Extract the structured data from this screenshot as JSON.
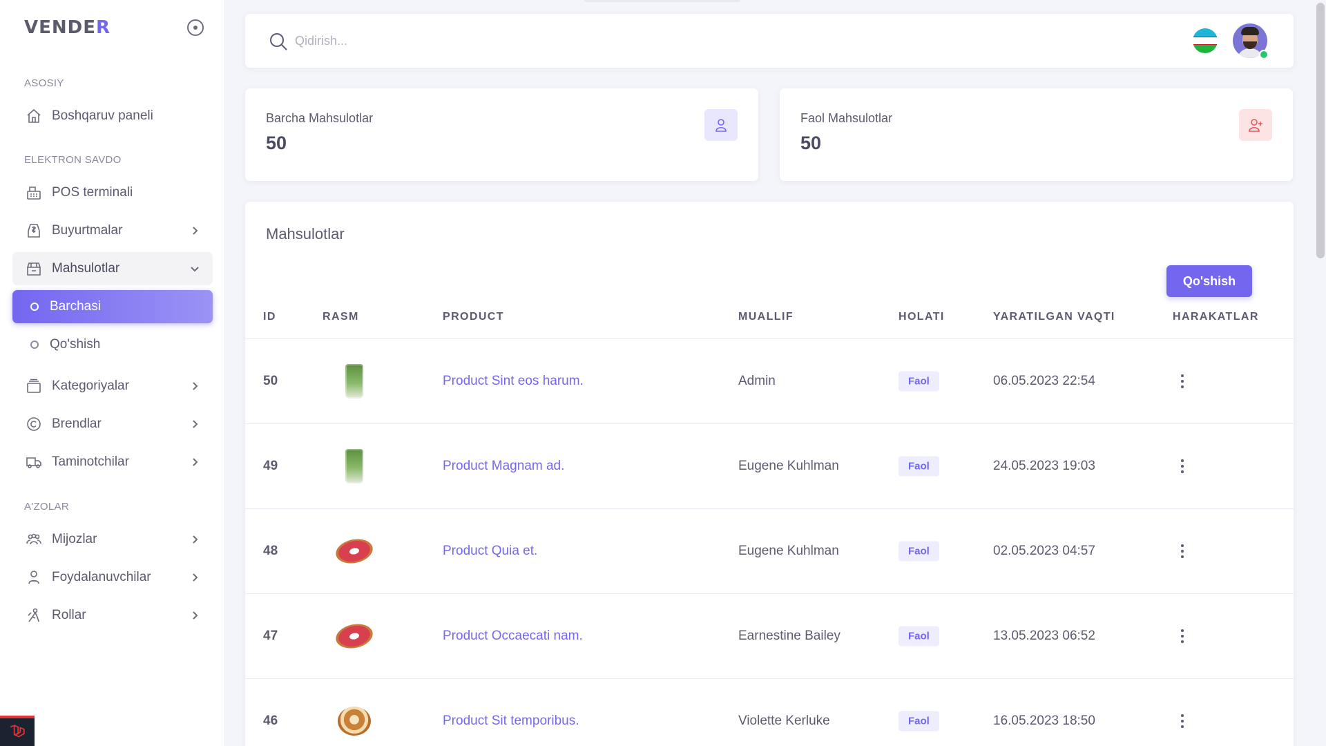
{
  "brand": {
    "text_main": "VENDE",
    "text_accent": "R"
  },
  "search": {
    "placeholder": "Qidirish..."
  },
  "colors": {
    "accent": "#7367f0",
    "danger": "#ea5455",
    "success": "#28c76f"
  },
  "sidebar": {
    "sections": [
      "ASOSIY",
      "ELEKTRON SAVDO",
      "A'ZOLAR"
    ],
    "items": [
      {
        "label": "Boshqaruv paneli",
        "icon": "home-icon"
      },
      {
        "label": "POS terminali",
        "icon": "cash-register-icon"
      },
      {
        "label": "Buyurtmalar",
        "icon": "order-icon"
      },
      {
        "label": "Mahsulotlar",
        "icon": "products-icon"
      },
      {
        "label": "Barchasi",
        "icon": "circle-icon"
      },
      {
        "label": "Qo'shish",
        "icon": "circle-icon"
      },
      {
        "label": "Kategoriyalar",
        "icon": "category-icon"
      },
      {
        "label": "Brendlar",
        "icon": "copyright-icon"
      },
      {
        "label": "Taminotchilar",
        "icon": "truck-icon"
      },
      {
        "label": "Mijozlar",
        "icon": "users-icon"
      },
      {
        "label": "Foydalanuvchilar",
        "icon": "user-icon"
      },
      {
        "label": "Rollar",
        "icon": "roles-icon"
      }
    ]
  },
  "stats": [
    {
      "label": "Barcha Mahsulotlar",
      "value": "50",
      "icon": "user-icon",
      "color": "#7367f0"
    },
    {
      "label": "Faol Mahsulotlar",
      "value": "50",
      "icon": "user-plus-icon",
      "color": "#ea5455"
    }
  ],
  "products": {
    "title": "Mahsulotlar",
    "add_label": "Qo'shish",
    "columns": [
      "ID",
      "RASM",
      "PRODUCT",
      "MUALLIF",
      "HOLATI",
      "YARATILGAN VAQTI",
      "HARAKATLAR"
    ],
    "rows": [
      {
        "id": "50",
        "image": "green-drink",
        "name": "Product Sint eos harum.",
        "author": "Admin",
        "status": "Faol",
        "created": "06.05.2023 22:54"
      },
      {
        "id": "49",
        "image": "green-drink",
        "name": "Product Magnam ad.",
        "author": "Eugene Kuhlman",
        "status": "Faol",
        "created": "24.05.2023 19:03"
      },
      {
        "id": "48",
        "image": "donut",
        "name": "Product Quia et.",
        "author": "Eugene Kuhlman",
        "status": "Faol",
        "created": "02.05.2023 04:57"
      },
      {
        "id": "47",
        "image": "donut",
        "name": "Product Occaecati nam.",
        "author": "Earnestine Bailey",
        "status": "Faol",
        "created": "13.05.2023 06:52"
      },
      {
        "id": "46",
        "image": "cinnamon-bun",
        "name": "Product Sit temporibus.",
        "author": "Violette Kerluke",
        "status": "Faol",
        "created": "16.05.2023 18:50"
      }
    ]
  }
}
